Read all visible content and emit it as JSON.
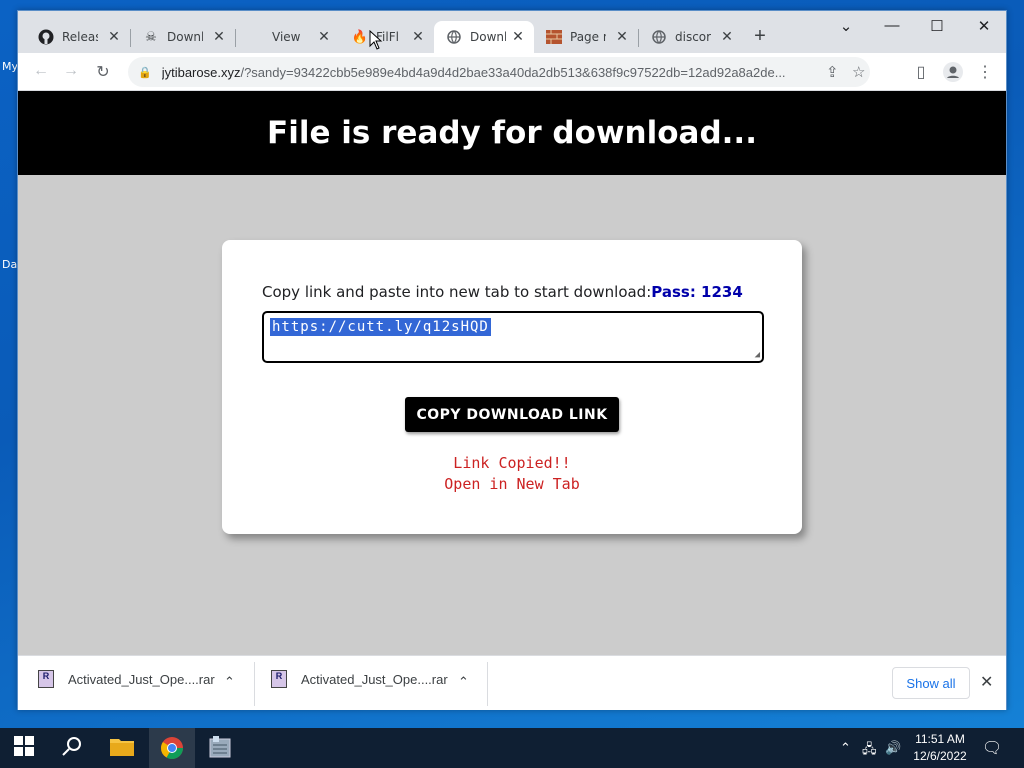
{
  "desktop": {
    "icon_labels": [
      "My",
      "Da"
    ]
  },
  "browser": {
    "tabs": [
      {
        "title": "Releas",
        "icon": "github-icon",
        "active": false
      },
      {
        "title": "Downl",
        "icon": "skull-icon",
        "active": false
      },
      {
        "title": "View",
        "icon": "none",
        "active": false
      },
      {
        "title": "FilFl",
        "icon": "flame-icon",
        "active": false
      },
      {
        "title": "Downl",
        "icon": "globe-icon",
        "active": true
      },
      {
        "title": "Page n",
        "icon": "brick-icon",
        "active": false
      },
      {
        "title": "discor",
        "icon": "globe-icon",
        "active": false
      }
    ],
    "url": {
      "domain": "jytibarose.xyz",
      "rest": "/?sandy=93422cbb5e989e4bd4a9d4d2bae33a40da2db513&638f9c97522db=12ad92a8a2de..."
    }
  },
  "page": {
    "banner_title": "File is ready for download...",
    "instruction": "Copy link and paste into new tab to start download:",
    "pass_label": "Pass: 1234",
    "link_value": "https://cutt.ly/q12sHQD",
    "copy_button": "COPY DOWNLOAD LINK",
    "status_copied": "Link Copied!!",
    "status_open": "Open in New Tab"
  },
  "downloads": {
    "items": [
      {
        "name": "Activated_Just_Ope....rar"
      },
      {
        "name": "Activated_Just_Ope....rar"
      }
    ],
    "show_all": "Show all"
  },
  "taskbar": {
    "time": "11:51 AM",
    "date": "12/6/2022"
  },
  "colors": {
    "banner": "#000000",
    "page_bg": "#cccccc",
    "pass": "#0000aa",
    "status": "#cc2222",
    "selection": "#3367d6"
  }
}
